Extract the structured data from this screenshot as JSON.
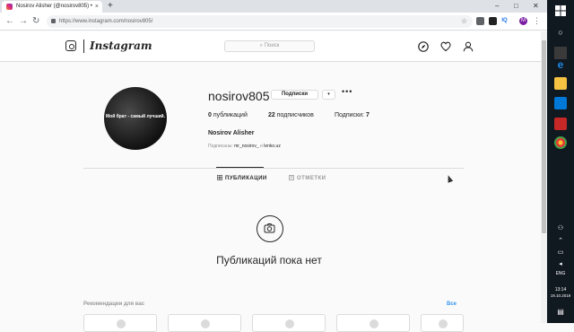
{
  "browser": {
    "tab_title": "Nosirov Alisher (@nosirov805) •",
    "tab_close": "×",
    "new_tab": "+",
    "url": "https://www.instagram.com/nosirov805/",
    "back": "←",
    "forward": "→",
    "reload": "↻",
    "star": "☆",
    "win_min": "–",
    "win_max": "□",
    "win_close": "✕",
    "menu": "⋮",
    "profile_initial": "M",
    "ext_iq": "IQ"
  },
  "ig": {
    "wordmark": "Instagram",
    "search_placeholder": "⌕ Поиск"
  },
  "profile": {
    "username": "nosirov805",
    "follow_label": "Подписки",
    "dropdown": "▾",
    "more": "•••",
    "avatar_text": "Мой брат - самый лучший.",
    "stats": {
      "posts_count": "0",
      "posts_label": "публикаций",
      "followers_count": "22",
      "followers_label": "подписчиков",
      "following_label": "Подписки:",
      "following_count": "7"
    },
    "full_name": "Nosirov Alisher",
    "followed_by_prefix": "Подписаны:",
    "followed_by_1": "mr_nosirov_",
    "followed_by_and": "и",
    "followed_by_2": "lenko.uz"
  },
  "tabs": {
    "posts": "ПУБЛИКАЦИИ",
    "tagged": "ОТМЕТКИ"
  },
  "empty_state": {
    "text": "Публикаций пока нет"
  },
  "recommendations": {
    "title": "Рекомендации для вас",
    "see_all": "Все"
  },
  "taskbar": {
    "lang": "ENG",
    "time": "13:14",
    "date": "19.10.2019"
  }
}
